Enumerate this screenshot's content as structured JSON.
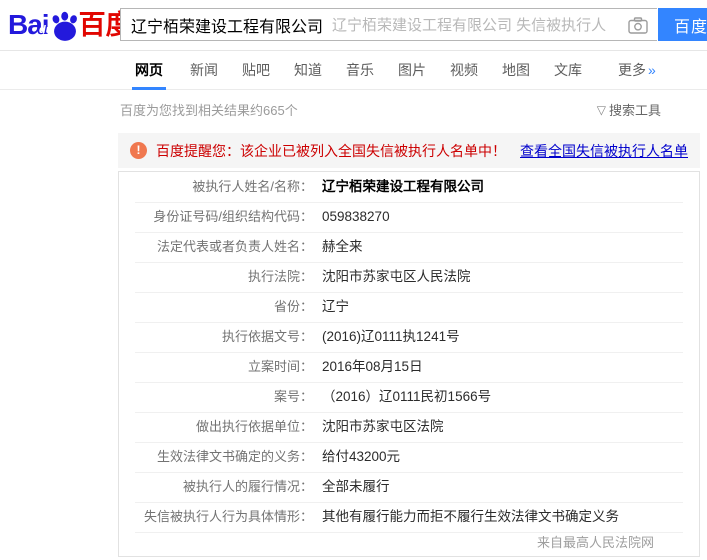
{
  "header": {
    "logo": {
      "bai": "Bai",
      "du": "du",
      "chinese": "百度"
    },
    "search": {
      "query": "辽宁栢荣建设工程有限公司",
      "suggestion": "辽宁栢荣建设工程有限公司 失信被执行人",
      "button_label": "百度一下"
    }
  },
  "nav": {
    "tabs": [
      {
        "label": "网页",
        "active": true
      },
      {
        "label": "新闻",
        "active": false
      },
      {
        "label": "贴吧",
        "active": false
      },
      {
        "label": "知道",
        "active": false
      },
      {
        "label": "音乐",
        "active": false
      },
      {
        "label": "图片",
        "active": false
      },
      {
        "label": "视频",
        "active": false
      },
      {
        "label": "地图",
        "active": false
      },
      {
        "label": "文库",
        "active": false
      }
    ],
    "more_label": "更多",
    "more_arrow": "»"
  },
  "results_bar": {
    "count_text": "百度为您找到相关结果约665个",
    "funnel_glyph": "▽",
    "tools_label": "搜索工具"
  },
  "alert": {
    "icon_glyph": "!",
    "message": "百度提醒您：该企业已被列入全国失信被执行人名单中！",
    "link_label": "查看全国失信被执行人名单"
  },
  "detail_card": {
    "rows": [
      {
        "label": "被执行人姓名/名称：",
        "value": "辽宁栢荣建设工程有限公司",
        "bold": true
      },
      {
        "label": "身份证号码/组织结构代码：",
        "value": "059838270",
        "bold": false
      },
      {
        "label": "法定代表或者负责人姓名：",
        "value": "赫全来",
        "bold": false
      },
      {
        "label": "执行法院：",
        "value": "沈阳市苏家屯区人民法院",
        "bold": false
      },
      {
        "label": "省份：",
        "value": "辽宁",
        "bold": false
      },
      {
        "label": "执行依据文号：",
        "value": "(2016)辽0111执1241号",
        "bold": false
      },
      {
        "label": "立案时间：",
        "value": "2016年08月15日",
        "bold": false
      },
      {
        "label": "案号：",
        "value": "（2016）辽0111民初1566号",
        "bold": false
      },
      {
        "label": "做出执行依据单位：",
        "value": "沈阳市苏家屯区法院",
        "bold": false
      },
      {
        "label": "生效法律文书确定的义务：",
        "value": "给付43200元",
        "bold": false
      },
      {
        "label": "被执行人的履行情况：",
        "value": "全部未履行",
        "bold": false
      },
      {
        "label": "失信被执行人行为具体情形：",
        "value": "其他有履行能力而拒不履行生效法律文书确定义务",
        "bold": false
      }
    ],
    "source": "来自最高人民法院网"
  },
  "colors": {
    "accent_blue": "#3385ff",
    "logo_blue": "#2319dc",
    "logo_red": "#e10601",
    "alert_red": "#cc0001",
    "alert_orange": "#f0784f",
    "link_blue": "#0000cc"
  }
}
